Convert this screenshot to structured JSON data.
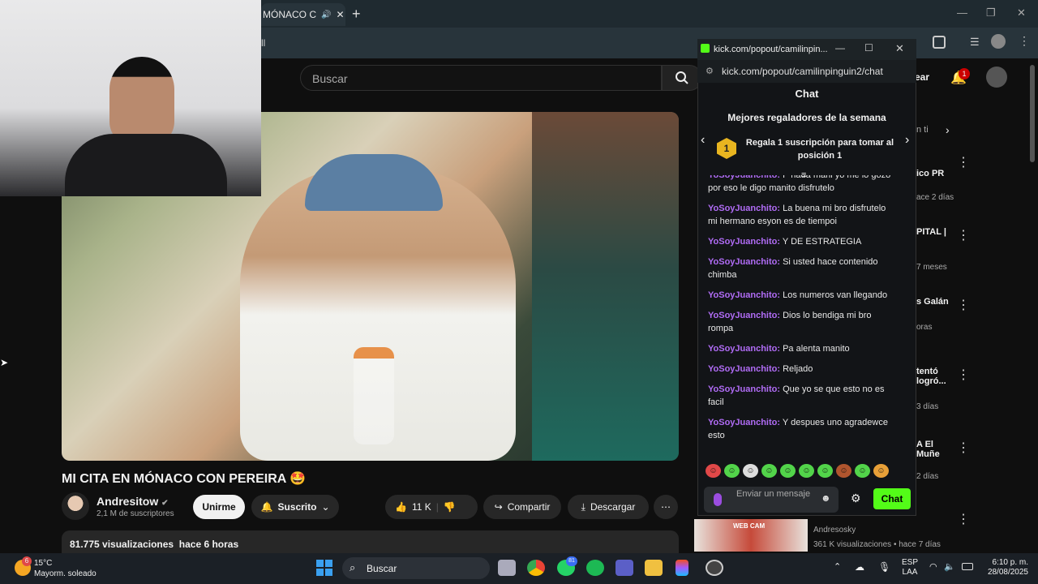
{
  "browser": {
    "tab_title": "MÓNACO C",
    "address_fragment": "ll",
    "new_tab": "+"
  },
  "youtube": {
    "search_placeholder": "Buscar",
    "video_title": "MI CITA EN MÓNACO CON PEREIRA 🤩",
    "channel_name": "Andresitow",
    "subscribers": "2,1 M de suscriptores",
    "join_label": "Unirme",
    "subscribed_label": "Suscrito",
    "likes": "11 K",
    "share_label": "Compartir",
    "download_label": "Descargar",
    "views": "81.775 visualizaciones",
    "age": "hace 6 horas",
    "header_right": "ear",
    "notif_count": "1",
    "recs": [
      {
        "title": "ico PR",
        "meta": "ace 2 días"
      },
      {
        "title": "PITAL |",
        "meta": "7 meses"
      },
      {
        "title": "s Galán",
        "meta": "oras"
      },
      {
        "title": "tentó logró...",
        "meta": "3 días"
      },
      {
        "title": "A El Muñe",
        "meta": "2 días"
      }
    ],
    "rec_filter": "n ti",
    "bottom_rec": {
      "channel": "Andresosky",
      "meta": "361 K visualizaciones • hace 7 días",
      "thumb_text": "WEB CAM"
    }
  },
  "popup": {
    "window_title": "kick.com/popout/camilinpin...",
    "url": "kick.com/popout/camilinpinguin2/chat",
    "chat_header": "Chat",
    "gifters_title": "Mejores regaladores de la semana",
    "gift_rank": "1",
    "gift_text": "Regala 1 suscripción para tomar al posición 1",
    "messages": [
      {
        "user": "YoSoyJuanchito:",
        "text": "P nada mani yo me lo gozo por eso le digo manito disfrutelo"
      },
      {
        "user": "YoSoyJuanchito:",
        "text": "La buena mi bro disfrutelo mi hermano esyon es de tiempoi"
      },
      {
        "user": "YoSoyJuanchito:",
        "text": "Y DE ESTRATEGIA"
      },
      {
        "user": "YoSoyJuanchito:",
        "text": "Si usted hace contenido chimba"
      },
      {
        "user": "YoSoyJuanchito:",
        "text": "Los numeros van llegando"
      },
      {
        "user": "YoSoyJuanchito:",
        "text": "Dios lo bendiga mi bro rompa"
      },
      {
        "user": "YoSoyJuanchito:",
        "text": "Pa alenta manito"
      },
      {
        "user": "YoSoyJuanchito:",
        "text": "Reljado"
      },
      {
        "user": "YoSoyJuanchito:",
        "text": "Que yo se que esto no es facil"
      },
      {
        "user": "YoSoyJuanchito:",
        "text": "Y despues uno agradewce esto"
      }
    ],
    "input_placeholder": "Enviar un mensaje",
    "send_label": "Chat",
    "accent": "#53fc18"
  },
  "taskbar": {
    "temp": "15°C",
    "weather": "Mayorm. soleado",
    "weather_badge": "6",
    "search": "Buscar",
    "whatsapp_badge": "81",
    "lang1": "ESP",
    "lang2": "LAA",
    "time": "6:10 p. m.",
    "date": "28/08/2025"
  }
}
